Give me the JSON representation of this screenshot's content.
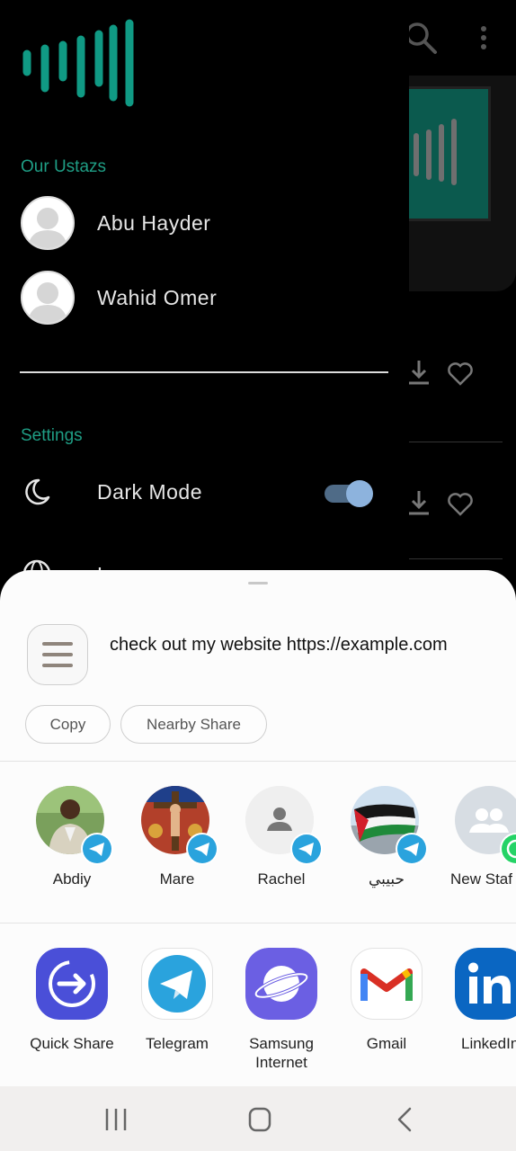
{
  "drawer": {
    "ustazs_title": "Our Ustazs",
    "ustazs": [
      {
        "name": "Abu Hayder"
      },
      {
        "name": "Wahid Omer"
      }
    ],
    "settings_title": "Settings",
    "settings": [
      {
        "label": "Dark Mode",
        "icon": "moon-icon",
        "toggle_on": true
      },
      {
        "label": "Language",
        "icon": "globe-icon"
      }
    ]
  },
  "share_sheet": {
    "text": "check out my website https://example.com",
    "actions": [
      {
        "label": "Copy"
      },
      {
        "label": "Nearby Share"
      }
    ],
    "contacts": [
      {
        "name": "Abdiy",
        "app": "telegram"
      },
      {
        "name": "Mare",
        "app": "telegram"
      },
      {
        "name": "Rachel",
        "app": "telegram"
      },
      {
        "name": "حبيبي",
        "app": "telegram"
      },
      {
        "name": "New Staf",
        "app": "whatsapp"
      }
    ],
    "apps": [
      {
        "name": "Quick Share"
      },
      {
        "name": "Telegram"
      },
      {
        "name": "Samsung\nInternet"
      },
      {
        "name": "Gmail"
      },
      {
        "name": "LinkedIn"
      }
    ]
  },
  "colors": {
    "accent": "#1f9e85",
    "telegram": "#2aa3dd",
    "sheet_bg": "#fcfcfc"
  }
}
